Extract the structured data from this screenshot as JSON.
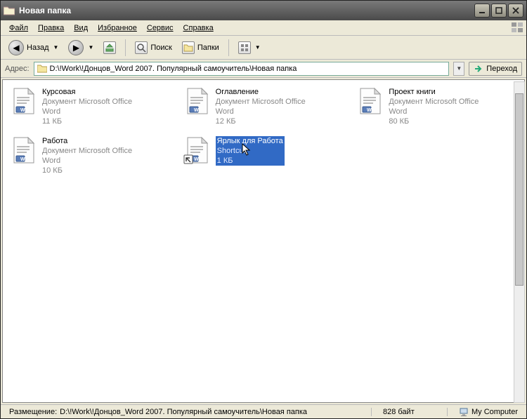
{
  "titlebar": {
    "title": "Новая папка"
  },
  "menu": {
    "file": "Файл",
    "edit": "Правка",
    "view": "Вид",
    "favorites": "Избранное",
    "tools": "Сервис",
    "help": "Справка"
  },
  "toolbar": {
    "back": "Назад",
    "search": "Поиск",
    "folders": "Папки"
  },
  "addrbar": {
    "label": "Адрес:",
    "path": "D:\\!Work\\!Донцов_Word 2007. Популярный самоучитель\\Новая папка",
    "go": "Переход"
  },
  "files": [
    {
      "name": "Курсовая",
      "type": "Документ Microsoft Office Word",
      "size": "11 КБ"
    },
    {
      "name": "Оглавление",
      "type": "Документ Microsoft Office Word",
      "size": "12 КБ"
    },
    {
      "name": "Проект книги",
      "type": "Документ Microsoft Office Word",
      "size": "80 КБ"
    },
    {
      "name": "Работа",
      "type": "Документ Microsoft Office Word",
      "size": "10 КБ"
    },
    {
      "name": "Ярлык для Работа",
      "type": "Shortcut",
      "size": "1 КБ",
      "selected": true,
      "shortcut": true
    }
  ],
  "status": {
    "location_label": "Размещение:",
    "location": "D:\\!Work\\!Донцов_Word 2007. Популярный самоучитель\\Новая папка",
    "size": "828 байт",
    "zone": "My Computer"
  }
}
